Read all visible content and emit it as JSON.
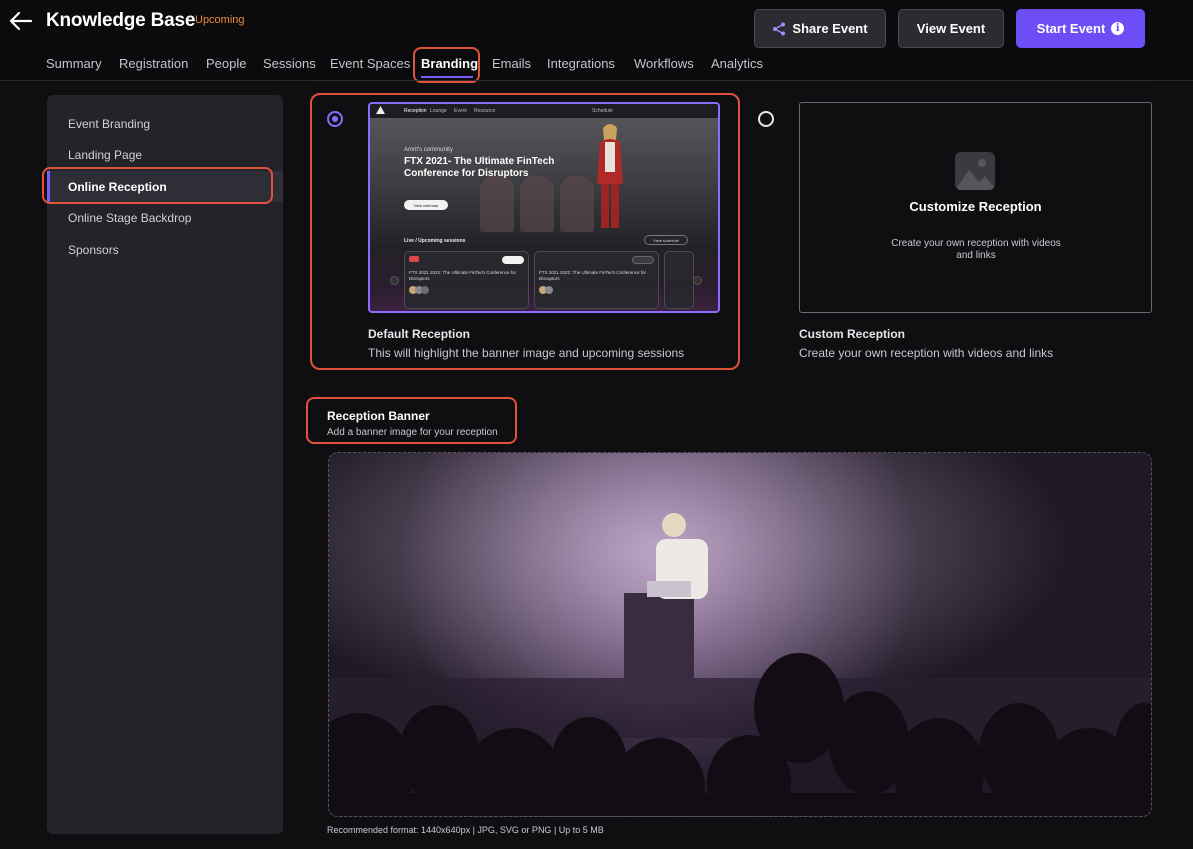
{
  "header": {
    "title": "Knowledge Base",
    "status_badge": "Upcoming",
    "buttons": {
      "share": "Share Event",
      "view": "View Event",
      "start": "Start Event"
    },
    "tabs": [
      "Summary",
      "Registration",
      "People",
      "Sessions",
      "Event Spaces",
      "Branding",
      "Emails",
      "Integrations",
      "Workflows",
      "Analytics"
    ],
    "active_tab": "Branding"
  },
  "sidebar": {
    "items": [
      "Event Branding",
      "Landing Page",
      "Online Reception",
      "Online Stage Backdrop",
      "Sponsors"
    ],
    "active": "Online Reception"
  },
  "reception_options": {
    "default": {
      "title": "Default Reception",
      "description": "This will highlight the banner image and upcoming sessions",
      "selected": true,
      "preview": {
        "nav_items": [
          "Reception",
          "Lounge",
          "Event",
          "Resource"
        ],
        "schedule_label": "Schedule",
        "community": "Amrit's community",
        "headline": "FTX 2021- The Ultimate FinTech Conference for Disruptors",
        "cta": "View calendar",
        "sessions_heading": "Live / Upcoming sessions",
        "view_schedule": "View schedule",
        "card_title": "FTX 2021 2022: The Ultimate FinTech Conference for Disruptors",
        "card_join": "Join now",
        "card_bookmark": "Bookmark"
      }
    },
    "custom": {
      "box_title": "Customize Reception",
      "box_description": "Create your own reception with videos and links",
      "title": "Custom Reception",
      "description": "Create your own reception with videos and links",
      "selected": false
    }
  },
  "reception_banner": {
    "title": "Reception Banner",
    "subtitle": "Add a banner image for your reception",
    "note": "Recommended format: 1440x640px | JPG, SVG or PNG | Up to 5 MB"
  },
  "colors": {
    "accent": "#6d4ef6",
    "badge": "#f0883a",
    "highlight": "#e0523a"
  }
}
